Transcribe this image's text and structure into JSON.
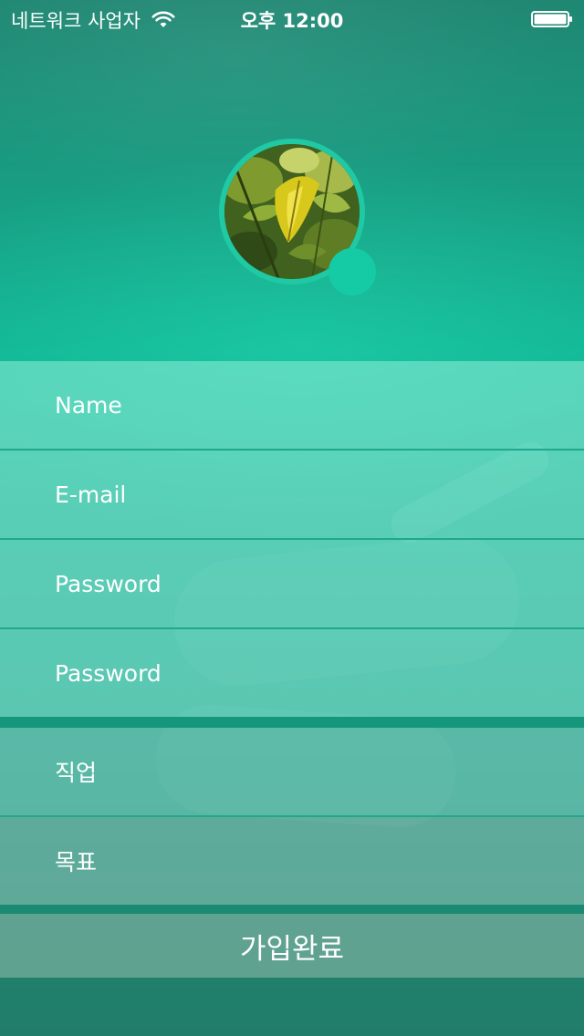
{
  "status_bar": {
    "carrier": "네트워크 사업자",
    "time": "오후 12:00",
    "wifi_icon": "wifi-icon",
    "battery_icon": "battery-full-icon"
  },
  "profile": {
    "photo_description_icon": "leaf-photo",
    "add_photo_icon": "circle-button"
  },
  "form": {
    "fields": [
      {
        "placeholder": "Name"
      },
      {
        "placeholder": "E-mail"
      },
      {
        "placeholder": "Password"
      },
      {
        "placeholder": "Password"
      },
      {
        "placeholder": "직업"
      },
      {
        "placeholder": "목표"
      }
    ],
    "submit_label": "가입완료"
  },
  "colors": {
    "accent": "#14cba6",
    "header_teal": "#10b594",
    "background_dark": "#217d69"
  }
}
